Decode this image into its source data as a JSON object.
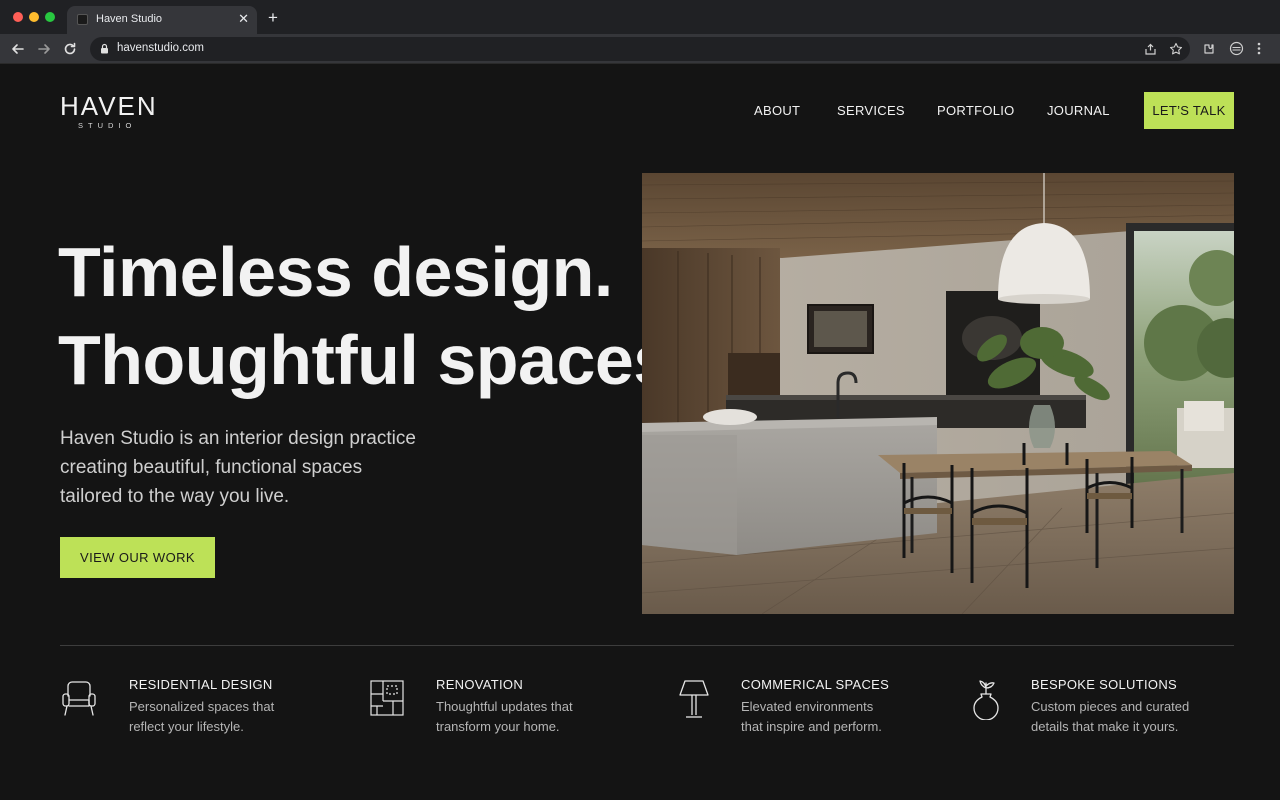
{
  "browser": {
    "tab_title": "Haven Studio",
    "url": "havenstudio.com",
    "tab_close": "✕",
    "new_tab": "+"
  },
  "site": {
    "logo": {
      "main": "HAVEN",
      "sub": "STUDIO"
    },
    "nav": [
      {
        "label": "ABOUT"
      },
      {
        "label": "SERVICES"
      },
      {
        "label": "PORTFOLIO"
      },
      {
        "label": "JOURNAL"
      }
    ],
    "nav_cta": "LET’S TALK",
    "colors": {
      "accent": "#bde157",
      "background": "#141414",
      "text": "#f2f2f2"
    }
  },
  "hero": {
    "headline_line1": "Timeless design.",
    "headline_line2": "Thoughtful spaces.",
    "intro_lines": [
      "Haven Studio is an interior design practice",
      "creating beautiful, functional spaces",
      "tailored to the way you live."
    ],
    "cta": "VIEW OUR WORK",
    "image_icon": "interior-photo"
  },
  "features": [
    {
      "icon": "armchair-icon",
      "title": "RESIDENTIAL DESIGN",
      "desc_lines": [
        "Personalized spaces that",
        "reflect your lifestyle."
      ]
    },
    {
      "icon": "floorplan-icon",
      "title": "RENOVATION",
      "desc_lines": [
        "Thoughtful updates that",
        "transform your home."
      ]
    },
    {
      "icon": "lamp-icon",
      "title": "COMMERICAL SPACES",
      "desc_lines": [
        "Elevated environments",
        "that inspire and perform."
      ]
    },
    {
      "icon": "vase-icon",
      "title": "BESPOKE SOLUTIONS",
      "desc_lines": [
        "Custom pieces and curated",
        "details that make it yours."
      ]
    }
  ]
}
